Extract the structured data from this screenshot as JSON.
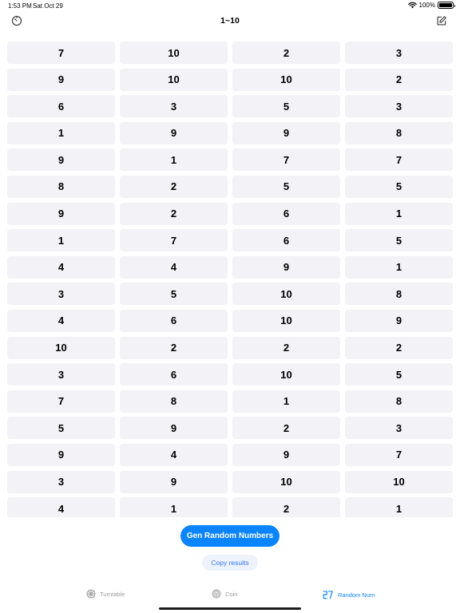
{
  "status_bar": {
    "time": "1:53 PM",
    "date": "Sat Oct 29",
    "battery": "100%"
  },
  "nav": {
    "title": "1~10",
    "left_icon": "timer-icon",
    "right_icon": "edit-icon"
  },
  "results": [
    [
      "7",
      "10",
      "2",
      "3"
    ],
    [
      "9",
      "10",
      "10",
      "2"
    ],
    [
      "6",
      "3",
      "5",
      "3"
    ],
    [
      "1",
      "9",
      "9",
      "8"
    ],
    [
      "9",
      "1",
      "7",
      "7"
    ],
    [
      "8",
      "2",
      "5",
      "5"
    ],
    [
      "9",
      "2",
      "6",
      "1"
    ],
    [
      "1",
      "7",
      "6",
      "5"
    ],
    [
      "4",
      "4",
      "9",
      "1"
    ],
    [
      "3",
      "5",
      "10",
      "8"
    ],
    [
      "4",
      "6",
      "10",
      "9"
    ],
    [
      "10",
      "2",
      "2",
      "2"
    ],
    [
      "3",
      "6",
      "10",
      "5"
    ],
    [
      "7",
      "8",
      "1",
      "8"
    ],
    [
      "5",
      "9",
      "2",
      "3"
    ],
    [
      "9",
      "4",
      "9",
      "7"
    ],
    [
      "3",
      "9",
      "10",
      "10"
    ],
    [
      "4",
      "1",
      "2",
      "1"
    ]
  ],
  "actions": {
    "generate_label": "Gen Random Numbers",
    "copy_label": "Copy results"
  },
  "tabs": [
    {
      "label": "Turntable",
      "icon": "turntable-icon",
      "active": false
    },
    {
      "label": "Coin",
      "icon": "coin-icon",
      "active": false
    },
    {
      "label": "Random Num",
      "icon": "random-number-icon",
      "active": true
    }
  ],
  "colors": {
    "accent": "#0a84ff",
    "cell_bg": "#f2f2f7",
    "inactive_tab": "#9b9b9b"
  }
}
